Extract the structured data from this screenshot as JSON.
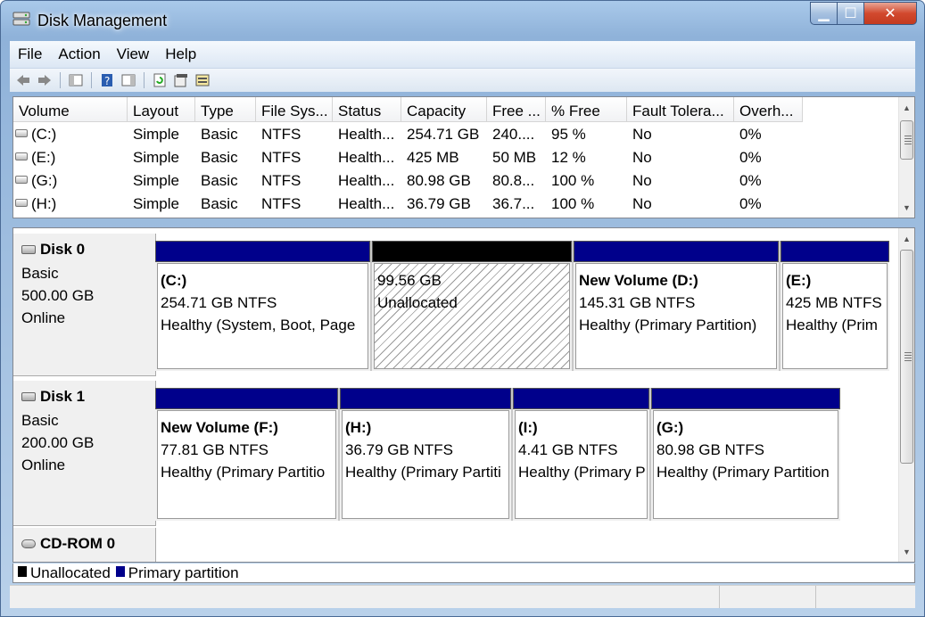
{
  "window": {
    "title": "Disk Management",
    "min": "▁",
    "max": "☐",
    "close": "✕"
  },
  "menu": [
    "File",
    "Action",
    "View",
    "Help"
  ],
  "toolbar": {
    "icons": [
      "back-icon",
      "forward-icon",
      "show-hide-console-tree-icon",
      "help-icon",
      "show-hide-action-pane-icon",
      "refresh-icon",
      "properties-icon",
      "rescan-disks-icon"
    ]
  },
  "volume_list": {
    "columns": [
      "Volume",
      "Layout",
      "Type",
      "File Sys...",
      "Status",
      "Capacity",
      "Free ...",
      "% Free",
      "Fault Tolera...",
      "Overh..."
    ],
    "rows": [
      [
        "(C:)",
        "Simple",
        "Basic",
        "NTFS",
        "Health...",
        "254.71 GB",
        "240....",
        "95 %",
        "No",
        "0%"
      ],
      [
        "(E:)",
        "Simple",
        "Basic",
        "NTFS",
        "Health...",
        "425 MB",
        "50 MB",
        "12 %",
        "No",
        "0%"
      ],
      [
        "(G:)",
        "Simple",
        "Basic",
        "NTFS",
        "Health...",
        "80.98 GB",
        "80.8...",
        "100 %",
        "No",
        "0%"
      ],
      [
        "(H:)",
        "Simple",
        "Basic",
        "NTFS",
        "Health...",
        "36.79 GB",
        "36.7...",
        "100 %",
        "No",
        "0%"
      ]
    ]
  },
  "disks": [
    {
      "name": "Disk 0",
      "type": "Basic",
      "size": "500.00 GB",
      "status": "Online",
      "partitions": [
        {
          "name": "(C:)",
          "size": "254.71 GB NTFS",
          "status": "Healthy (System, Boot, Page"
        },
        {
          "name": "",
          "size": "99.56 GB",
          "status": "Unallocated"
        },
        {
          "name": "New Volume  (D:)",
          "size": "145.31 GB NTFS",
          "status": "Healthy (Primary Partition)"
        },
        {
          "name": "(E:)",
          "size": "425 MB NTFS",
          "status": "Healthy (Prim"
        }
      ]
    },
    {
      "name": "Disk 1",
      "type": "Basic",
      "size": "200.00 GB",
      "status": "Online",
      "partitions": [
        {
          "name": "New Volume  (F:)",
          "size": "77.81 GB NTFS",
          "status": "Healthy (Primary Partitio"
        },
        {
          "name": "(H:)",
          "size": "36.79 GB NTFS",
          "status": "Healthy (Primary Partiti"
        },
        {
          "name": "(I:)",
          "size": "4.41 GB NTFS",
          "status": "Healthy (Primary P"
        },
        {
          "name": "(G:)",
          "size": "80.98 GB NTFS",
          "status": "Healthy (Primary Partition"
        }
      ]
    },
    {
      "name": "CD-ROM 0"
    }
  ],
  "legend": [
    {
      "label": "Unallocated",
      "color": "#000000"
    },
    {
      "label": "Primary partition",
      "color": "#00008b"
    }
  ],
  "colors": {
    "primary_partition": "#00008b",
    "unallocated": "#000000"
  }
}
